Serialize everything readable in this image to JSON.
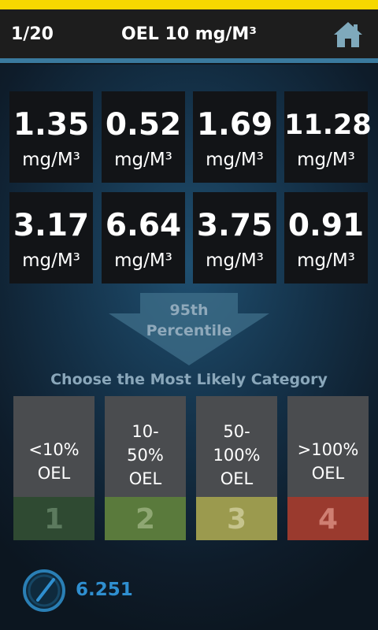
{
  "header": {
    "counter": "1/20",
    "title": "OEL 10 mg/M³",
    "home_icon": "home-icon"
  },
  "measurements": [
    {
      "value": "1.35",
      "unit": "mg/M³"
    },
    {
      "value": "0.52",
      "unit": "mg/M³"
    },
    {
      "value": "1.69",
      "unit": "mg/M³"
    },
    {
      "value": "11.28",
      "unit": "mg/M³"
    },
    {
      "value": "3.17",
      "unit": "mg/M³"
    },
    {
      "value": "6.64",
      "unit": "mg/M³"
    },
    {
      "value": "3.75",
      "unit": "mg/M³"
    },
    {
      "value": "0.91",
      "unit": "mg/M³"
    }
  ],
  "percentile_arrow": {
    "line1": "95th",
    "line2": "Percentile"
  },
  "prompt": "Choose the Most Likely Category",
  "categories": [
    {
      "line1": "<10%",
      "line2": "OEL",
      "line3": "",
      "number": "1",
      "color": "#2f4a32",
      "numcolor": "#5c7a5e"
    },
    {
      "line1": "10-",
      "line2": "50%",
      "line3": "OEL",
      "number": "2",
      "color": "#5a7a3c",
      "numcolor": "#8fa773"
    },
    {
      "line1": "50-",
      "line2": "100%",
      "line3": "OEL",
      "number": "3",
      "color": "#9b9a4e",
      "numcolor": "#c6c48d"
    },
    {
      "line1": ">100%",
      "line2": "OEL",
      "line3": "",
      "number": "4",
      "color": "#9a3a2e",
      "numcolor": "#cf7f72"
    }
  ],
  "score": {
    "value": "6.251",
    "icon": "gauge-icon"
  },
  "colors": {
    "statusbar": "#f6d800",
    "accent": "#3a7a9e",
    "score": "#2f8fd0"
  }
}
